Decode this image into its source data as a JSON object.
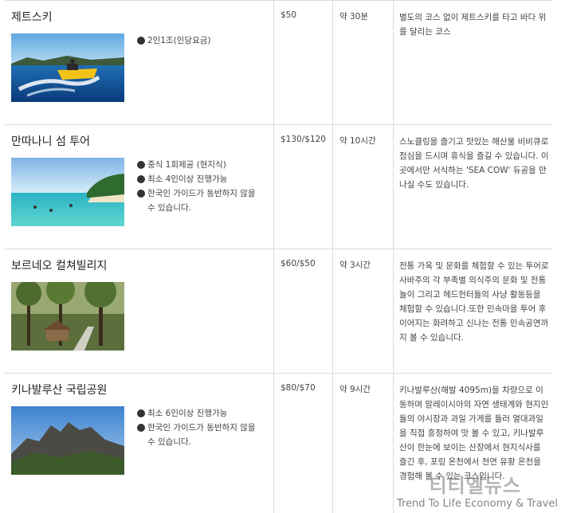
{
  "tours": [
    {
      "name": "제트스키",
      "notes": [
        "2인1조(인당요금)"
      ],
      "price": "$50",
      "duration": "약 30분",
      "description": "별도의 코스 없이 제트스키를 타고 바다 위를 달리는 코스"
    },
    {
      "name": "만따나니 섬 투어",
      "notes": [
        "중식 1회제공 (현지식)",
        "최소 4인이상 진행가능",
        "한국인 가이드가 동반하지 않을 수 있습니다."
      ],
      "price": "$130/$120",
      "duration": "약 10시간",
      "description": "스노클링을 즐기고 맛있는 해산물 비비큐로 점심을 드시며 휴식을 즐길 수 있습니다. 이곳에서만 서식하는 'SEA COW' 듀공을 만나실 수도 있습니다."
    },
    {
      "name": "보르네오 컬쳐빌리지",
      "notes": [],
      "price": "$60/$50",
      "duration": "약 3시간",
      "description": "전통 가옥 및 문화를 체험할 수 있는 투어로 사바주의 각 부족별 의식주의 문화 및 전통놀이 그리고 헤드헌터들의 사냥 활동등을 체험할 수 있습니다.또한 민속마을 투어 후 이어지는 화려하고 신나는 전통 민속공연까지 볼 수 있습니다."
    },
    {
      "name": "키나발루산 국립공원",
      "notes": [
        "최소 6인이상 진행가능",
        "한국인 가이드가 동반하지 않을 수 있습니다."
      ],
      "price": "$80/$70",
      "duration": "약 9시간",
      "description": "키나발루산(해발 4095m)을 차량으로 이동하며 말레이시아의 자연 생태계와 현지인들의 야시장과 과일 가게를 들러 열대과일을 직접 흥정하여 맛 볼 수 있고, 키나발루산이 한눈에 보이는 산장에서 현지식사를 즐긴 후, 포링 온천에서 천연 유황 온천을 경험해 볼 수 있는 코스입니다."
    }
  ],
  "watermark": {
    "main": "티티엘뉴스",
    "sub": "Trend To Life Economy & Travel"
  }
}
